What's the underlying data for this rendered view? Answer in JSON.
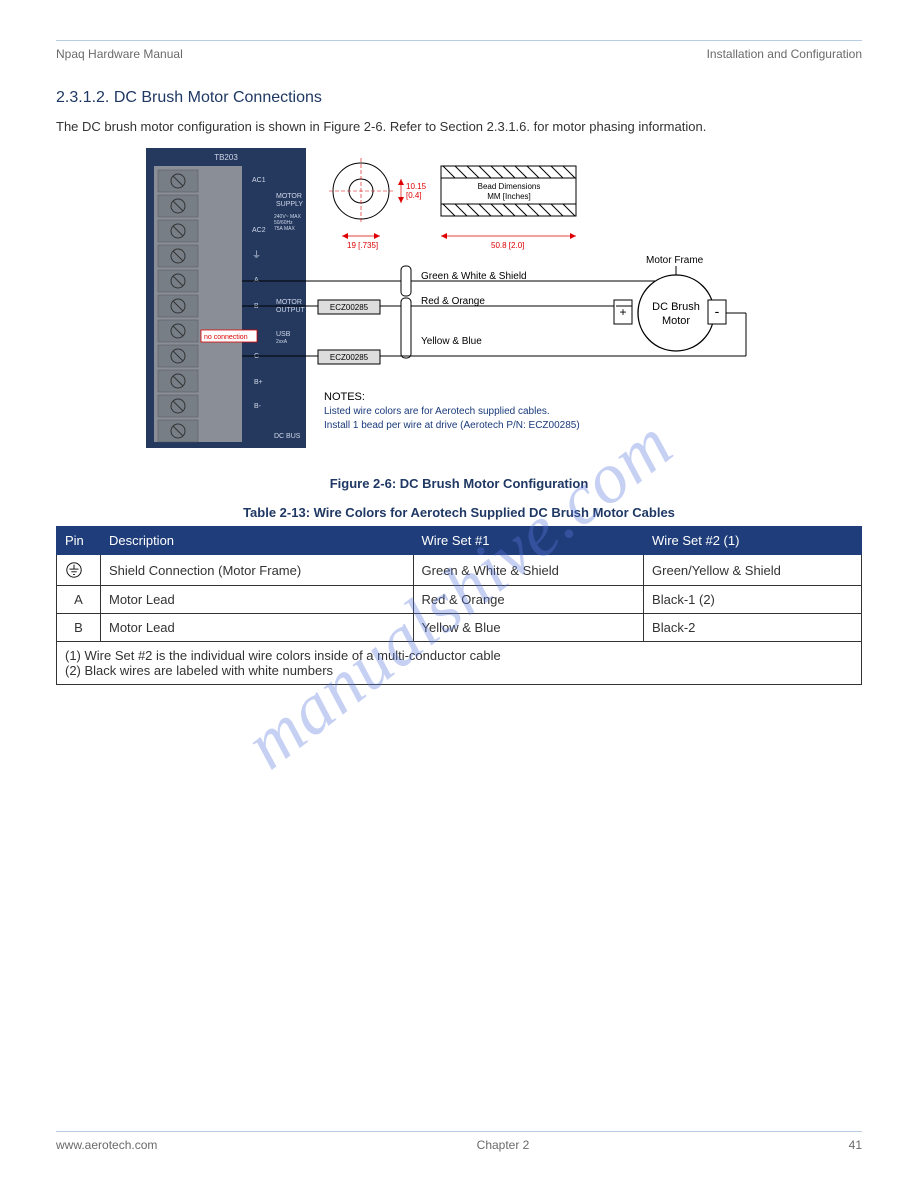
{
  "header": {
    "left": "Npaq Hardware Manual",
    "right": "Installation and Configuration"
  },
  "section_title": "2.3.1.2. DC Brush Motor Connections",
  "body_text": "The DC brush motor configuration is shown in Figure 2-6. Refer to Section 2.3.1.6. for motor phasing information.",
  "figure": {
    "caption": "Figure 2-6:     DC Brush Motor Configuration",
    "terminal": {
      "title": "TB203",
      "labels_right": [
        "AC1",
        "MOTOR SUPPLY",
        "240V~ MAX\n50/60Hz\n75A MAX",
        "AC2",
        "⏚",
        "A",
        "MOTOR OUTPUT",
        "B",
        "no connection",
        "USB 2xxA",
        "C",
        "B+",
        "B-",
        "DC BUS"
      ]
    },
    "bead": {
      "dim_v": "10.15 [0.4]",
      "dim_w": "19 [.735]",
      "dim_l": "50.8 [2.0]",
      "label": "Bead Dimensions MM [Inches]"
    },
    "wires": {
      "frame": "Motor Frame",
      "green": "Green & White & Shield",
      "red": "Red & Orange",
      "yellow": "Yellow & Blue",
      "ferrite": "ECZ00285",
      "motor": "DC Brush Motor"
    },
    "notes_title": "NOTES:",
    "note1": "Listed wire colors are for Aerotech supplied cables.",
    "note2": "Install 1 bead per wire at drive (Aerotech P/N: ECZ00285)"
  },
  "table": {
    "caption": "Table 2-13:     Wire Colors for Aerotech Supplied DC Brush Motor Cables",
    "headers": [
      "Pin",
      "Description",
      "Wire Set #1",
      "Wire Set #2 (1)"
    ],
    "rows": [
      [
        "__GND__",
        "Shield Connection (Motor Frame)",
        "Green & White & Shield",
        "Green/Yellow & Shield"
      ],
      [
        "A",
        "Motor Lead",
        "Red & Orange",
        "Black-1 (2)"
      ],
      [
        "B",
        "Motor Lead",
        "Yellow & Blue",
        "Black-2"
      ]
    ],
    "foot1": "(1) Wire Set #2 is the individual wire colors inside of a multi-conductor cable",
    "foot2": "(2) Black wires are labeled with white numbers"
  },
  "watermark": "manualshive.com",
  "footer": {
    "left": "www.aerotech.com",
    "center": "Chapter 2",
    "right": "41"
  }
}
